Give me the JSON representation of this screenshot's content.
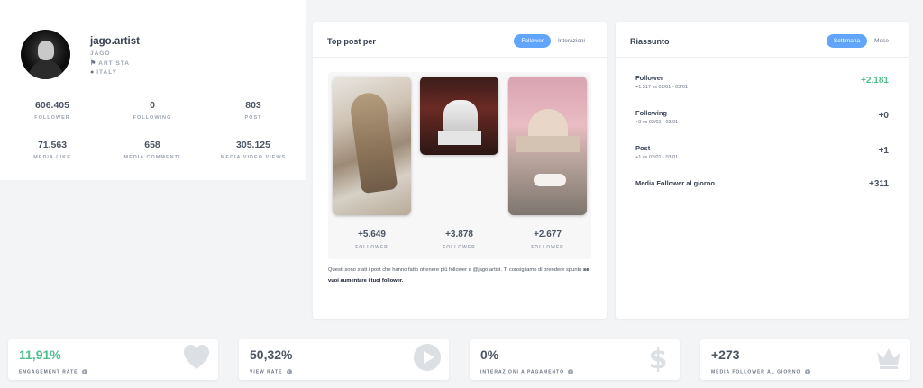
{
  "profile": {
    "username": "jago.artist",
    "name": "JAGO",
    "category": "ARTISTA",
    "country": "ITALY",
    "stats": [
      {
        "value": "606.405",
        "label": "FOLLOWER"
      },
      {
        "value": "0",
        "label": "FOLLOWING"
      },
      {
        "value": "803",
        "label": "POST"
      },
      {
        "value": "71.563",
        "label": "MEDIA LIKE"
      },
      {
        "value": "658",
        "label": "MEDIA COMMENTI"
      },
      {
        "value": "305.125",
        "label": "MEDIA VIDEO VIEWS"
      }
    ]
  },
  "top_posts": {
    "title": "Top post per",
    "toggle_active": "Follower",
    "toggle_inactive": "Interazioni",
    "posts": [
      {
        "value": "+5.649",
        "label": "FOLLOWER"
      },
      {
        "value": "+3.878",
        "label": "FOLLOWER"
      },
      {
        "value": "+2.677",
        "label": "FOLLOWER"
      }
    ],
    "note_text": "Questi sono stati i post che hanno fatto ottenere più follower a @jago.artist. Ti consigliamo di prendere spunto ",
    "note_bold": "se vuoi aumentare i tuoi follower."
  },
  "summary": {
    "title": "Riassunto",
    "toggle_active": "Settimana",
    "toggle_inactive": "Mese",
    "rows": [
      {
        "key": "Follower",
        "sub": "+1.517 vs 02/01 - 03/01",
        "value": "+2.181"
      },
      {
        "key": "Following",
        "sub": "+0 vs 02/01 - 03/01",
        "value": "+0"
      },
      {
        "key": "Post",
        "sub": "+1 vs 02/01 - 03/01",
        "value": "+1"
      },
      {
        "key": "Media Follower al giorno",
        "sub": "",
        "value": "+311"
      }
    ]
  },
  "kpis": [
    {
      "value": "11,91%",
      "label": "ENGAGEMENT RATE",
      "icon": "heart-icon"
    },
    {
      "value": "50,32%",
      "label": "VIEW RATE",
      "icon": "play-icon"
    },
    {
      "value": "0%",
      "label": "INTERAZIONI A PAGAMENTO",
      "icon": "dollar-icon"
    },
    {
      "value": "+273",
      "label": "MEDIA FOLLOWER AL GIORNO",
      "icon": "crown-icon"
    }
  ],
  "colors": {
    "accent": "#60a5fa",
    "positive": "#4fbf8f"
  }
}
